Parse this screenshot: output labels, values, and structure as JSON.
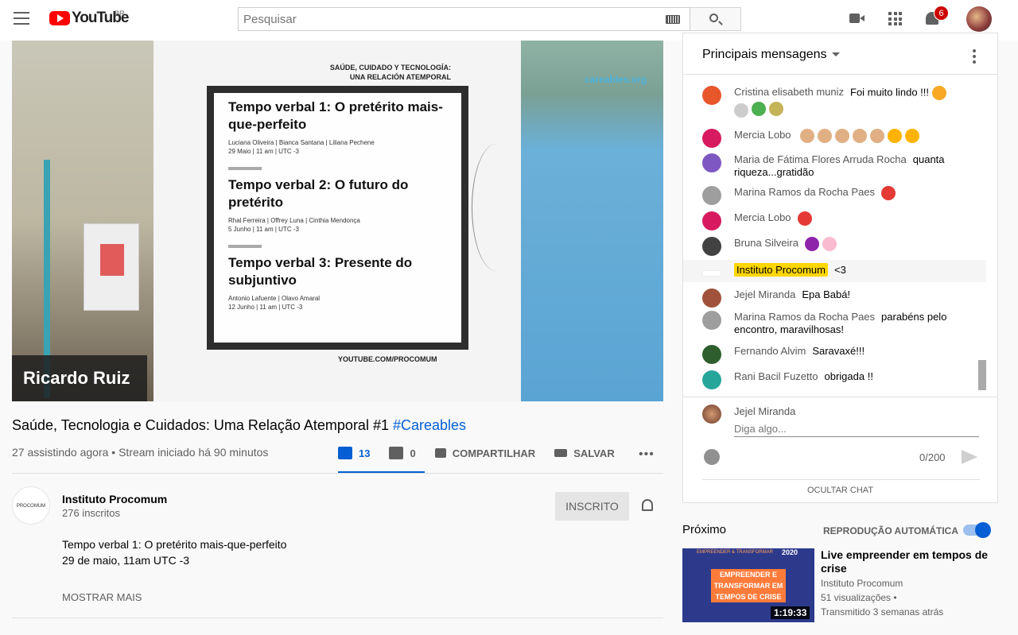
{
  "header": {
    "logo_text": "YouTube",
    "country": "BR",
    "search_placeholder": "Pesquisar",
    "notifications_count": "6"
  },
  "video": {
    "presenter_name": "Ricardo Ruiz",
    "slide": {
      "header_line1": "SAÚDE, CUIDADO Y TECNOLOGÍA:",
      "header_line2": "UNA RELACIÓN ATEMPORAL",
      "items": [
        {
          "title": "Tempo verbal 1: O pretérito mais-que-perfeito",
          "people": "Luciana Oliveira | Bianca Santana | Liliana Pechene",
          "date": "29 Maio | 11 am | UTC -3"
        },
        {
          "title": "Tempo verbal 2: O futuro do pretérito",
          "people": "Rhal Ferreira | Offrey Luna | Cinthia Mendonça",
          "date": "5 Junho | 11 am | UTC -3"
        },
        {
          "title": "Tempo verbal 3: Presente do subjuntivo",
          "people": "Antonio Lafuente | Olavo Amaral",
          "date": "12 Junho | 11 am | UTC -3"
        }
      ],
      "footer": "YOUTUBE.COM/PROCOMUM"
    },
    "watermark": "careables.org",
    "title_main": "Saúde, Tecnologia e Cuidados: Uma Relação Atemporal #1 ",
    "title_tag": "#Careables",
    "meta": "27 assistindo agora • Stream iniciado há 90 minutos",
    "likes": "13",
    "dislikes": "0",
    "share_label": "COMPARTILHAR",
    "save_label": "SALVAR",
    "more_dots": "•••"
  },
  "channel": {
    "avatar_text": "PROCOMUM",
    "name": "Instituto Procomum",
    "subscribers": "276 inscritos",
    "subscribe_label": "INSCRITO",
    "description_line1": "Tempo verbal 1: O pretérito mais-que-perfeito",
    "description_line2": "29 de maio, 11am UTC -3",
    "show_more": "MOSTRAR MAIS"
  },
  "chat": {
    "title": "Principais mensagens",
    "messages": [
      {
        "author": "Cristina elisabeth muniz",
        "text": "Foi muito lindo !!!",
        "color": "#e8562b"
      },
      {
        "author": "Mercia Lobo",
        "text": "",
        "color": "#d81b60"
      },
      {
        "author": "Maria de Fátima Flores Arruda Rocha",
        "text": "quanta riqueza...gratidão",
        "color": "#7e57c2"
      },
      {
        "author": "Marina Ramos da Rocha Paes",
        "text": "",
        "color": "#8a8a8a"
      },
      {
        "author": "Mercia Lobo",
        "text": "",
        "color": "#d81b60"
      },
      {
        "author": "Bruna Silveira",
        "text": "",
        "color": "#424242"
      },
      {
        "author": "Instituto Procomum",
        "text": "<3",
        "color": "#ffffff"
      },
      {
        "author": "Jejel Miranda",
        "text": "Epa Babá!",
        "color": "#a0523a"
      },
      {
        "author": "Marina Ramos da Rocha Paes",
        "text": "parabéns pelo encontro, maravilhosas!",
        "color": "#8a8a8a"
      },
      {
        "author": "Fernando Alvim",
        "text": "Saravaxé!!!",
        "color": "#2e5e2e"
      },
      {
        "author": "Rani Bacil Fuzetto",
        "text": "obrigada !!",
        "color": "#26a69a"
      }
    ],
    "input_author": "Jejel Miranda",
    "input_placeholder": "Diga algo...",
    "counter": "0/200",
    "hide_label": "OCULTAR CHAT"
  },
  "up_next": {
    "label": "Próximo",
    "autoplay_label": "REPRODUÇÃO AUTOMÁTICA",
    "autoplay_on": true,
    "thumb_top": "EMPREENDER & TRANSFORMAR",
    "thumb_year": "2020",
    "thumb_text": "EMPREENDER E TRANSFORMAR EM TEMPOS DE CRISE",
    "duration": "1:19:33",
    "title": "Live empreender em tempos de crise",
    "channel": "Instituto Procomum",
    "views": "51 visualizações •",
    "when": "Transmitido 3 semanas atrás"
  }
}
